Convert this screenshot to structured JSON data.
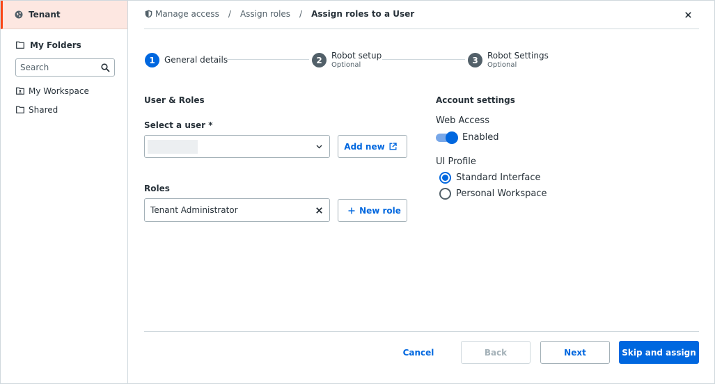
{
  "sidebar": {
    "tenant_label": "Tenant",
    "folders_label": "My Folders",
    "search_placeholder": "Search",
    "items": [
      {
        "label": "My Workspace"
      },
      {
        "label": "Shared"
      }
    ]
  },
  "breadcrumb": {
    "items": [
      "Manage access",
      "Assign roles"
    ],
    "separator": "/",
    "current": "Assign roles to a User"
  },
  "stepper": {
    "steps": [
      {
        "number": "1",
        "label": "General details",
        "sub": ""
      },
      {
        "number": "2",
        "label": "Robot setup",
        "sub": "Optional"
      },
      {
        "number": "3",
        "label": "Robot Settings",
        "sub": "Optional"
      }
    ]
  },
  "form": {
    "section_title": "User & Roles",
    "user_label": "Select a user *",
    "add_new_label": "Add new",
    "roles_label": "Roles",
    "roles_value": "Tenant Administrator",
    "new_role_label": "New role"
  },
  "account": {
    "title": "Account settings",
    "web_access_label": "Web Access",
    "web_access_state": "Enabled",
    "ui_profile_label": "UI Profile",
    "ui_options": [
      {
        "label": "Standard Interface",
        "selected": true
      },
      {
        "label": "Personal Workspace",
        "selected": false
      }
    ]
  },
  "footer": {
    "cancel": "Cancel",
    "back": "Back",
    "next": "Next",
    "primary": "Skip and assign"
  },
  "colors": {
    "accent": "#0067df",
    "tenant_highlight": "#fde7e1",
    "tenant_border": "#fa4616"
  }
}
